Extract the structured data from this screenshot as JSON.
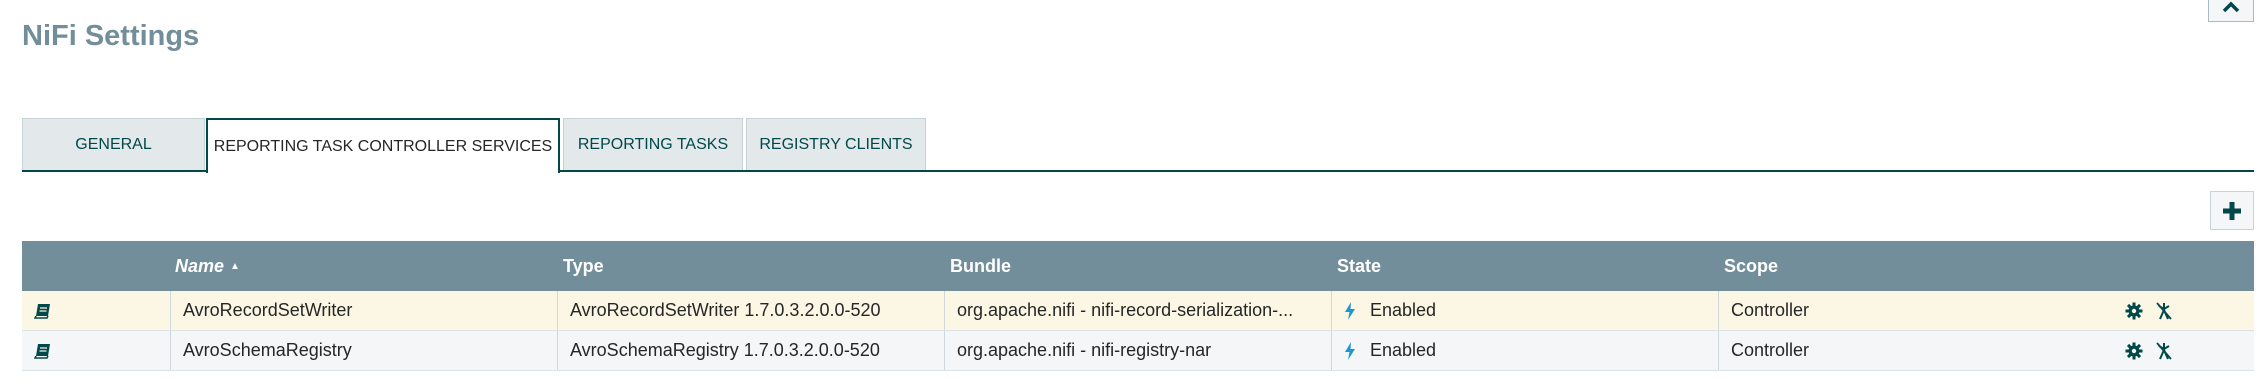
{
  "title": "NiFi Settings",
  "tabs": [
    {
      "label": "GENERAL"
    },
    {
      "label": "REPORTING TASK CONTROLLER SERVICES"
    },
    {
      "label": "REPORTING TASKS"
    },
    {
      "label": "REGISTRY CLIENTS"
    }
  ],
  "selected_tab": "REPORTING TASK CONTROLLER SERVICES",
  "columns": {
    "name": "Name",
    "type": "Type",
    "bundle": "Bundle",
    "state": "State",
    "scope": "Scope"
  },
  "sort": {
    "column": "Name",
    "direction": "ascending"
  },
  "rows": [
    {
      "name": "AvroRecordSetWriter",
      "type": "AvroRecordSetWriter 1.7.0.3.2.0.0-520",
      "bundle": "org.apache.nifi - nifi-record-serialization-...",
      "state": "Enabled",
      "scope": "Controller"
    },
    {
      "name": "AvroSchemaRegistry",
      "type": "AvroSchemaRegistry 1.7.0.3.2.0.0-520",
      "bundle": "org.apache.nifi - nifi-registry-nar",
      "state": "Enabled",
      "scope": "Controller"
    }
  ],
  "icons": {
    "close": "close-icon",
    "add": "plus-icon",
    "usage": "book-icon",
    "state": "lightning-icon",
    "configure": "gear-icon",
    "disable": "disable-icon"
  },
  "colors": {
    "title": "#728e9b",
    "accent": "#004849",
    "header_bg": "#728e9b",
    "row_odd": "#fcf7e5",
    "row_even": "#f4f6f7"
  }
}
